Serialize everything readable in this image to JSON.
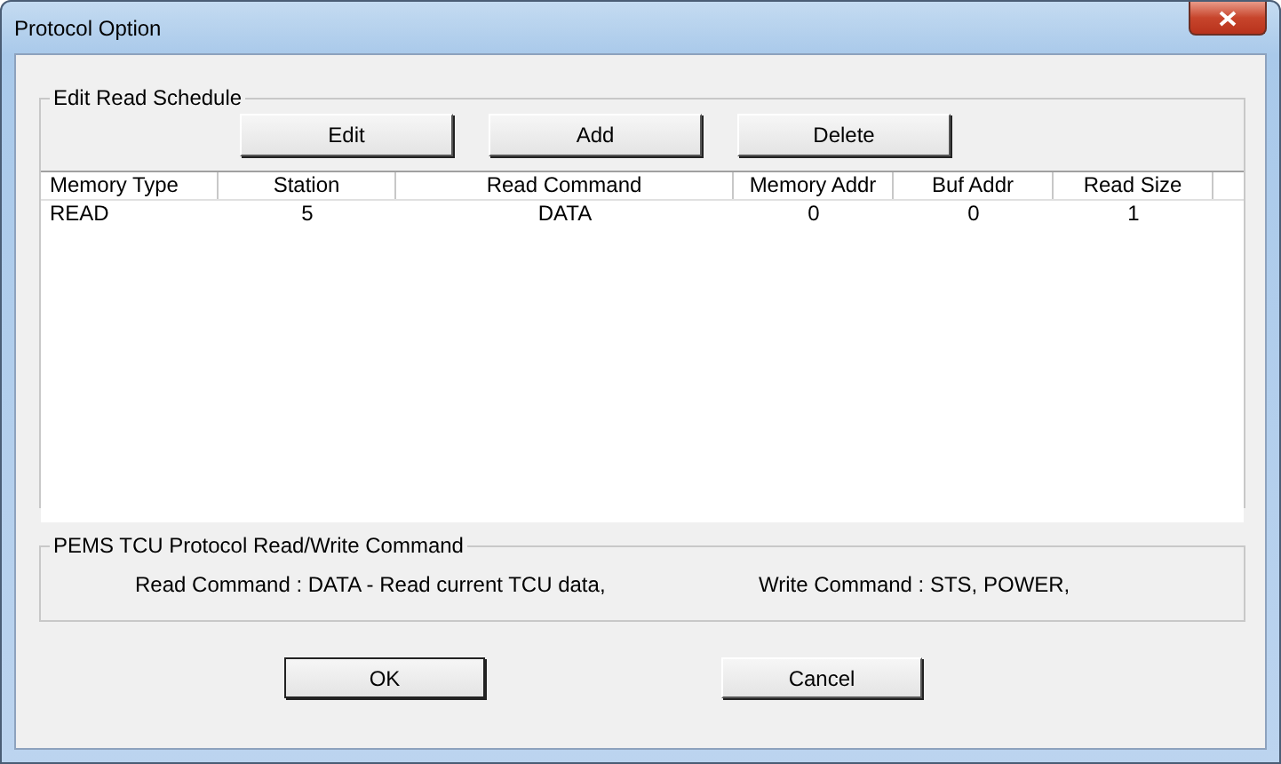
{
  "window": {
    "title": "Protocol Option"
  },
  "schedule": {
    "title": "Edit Read Schedule",
    "buttons": [
      "Edit",
      "Add",
      "Delete"
    ],
    "columns": [
      "Memory Type",
      "Station",
      "Read Command",
      "Memory Addr",
      "Buf Addr",
      "Read Size"
    ],
    "rows": [
      {
        "cells": [
          "READ",
          "5",
          "DATA",
          "0",
          "0",
          "1"
        ]
      }
    ]
  },
  "commands": {
    "title": "PEMS TCU Protocol Read/Write Command",
    "read": "Read Command : DATA - Read current TCU data,",
    "write": "Write Command : STS, POWER,"
  },
  "buttons": [
    {
      "label": "OK",
      "default": true
    },
    {
      "label": "Cancel",
      "default": false
    }
  ]
}
